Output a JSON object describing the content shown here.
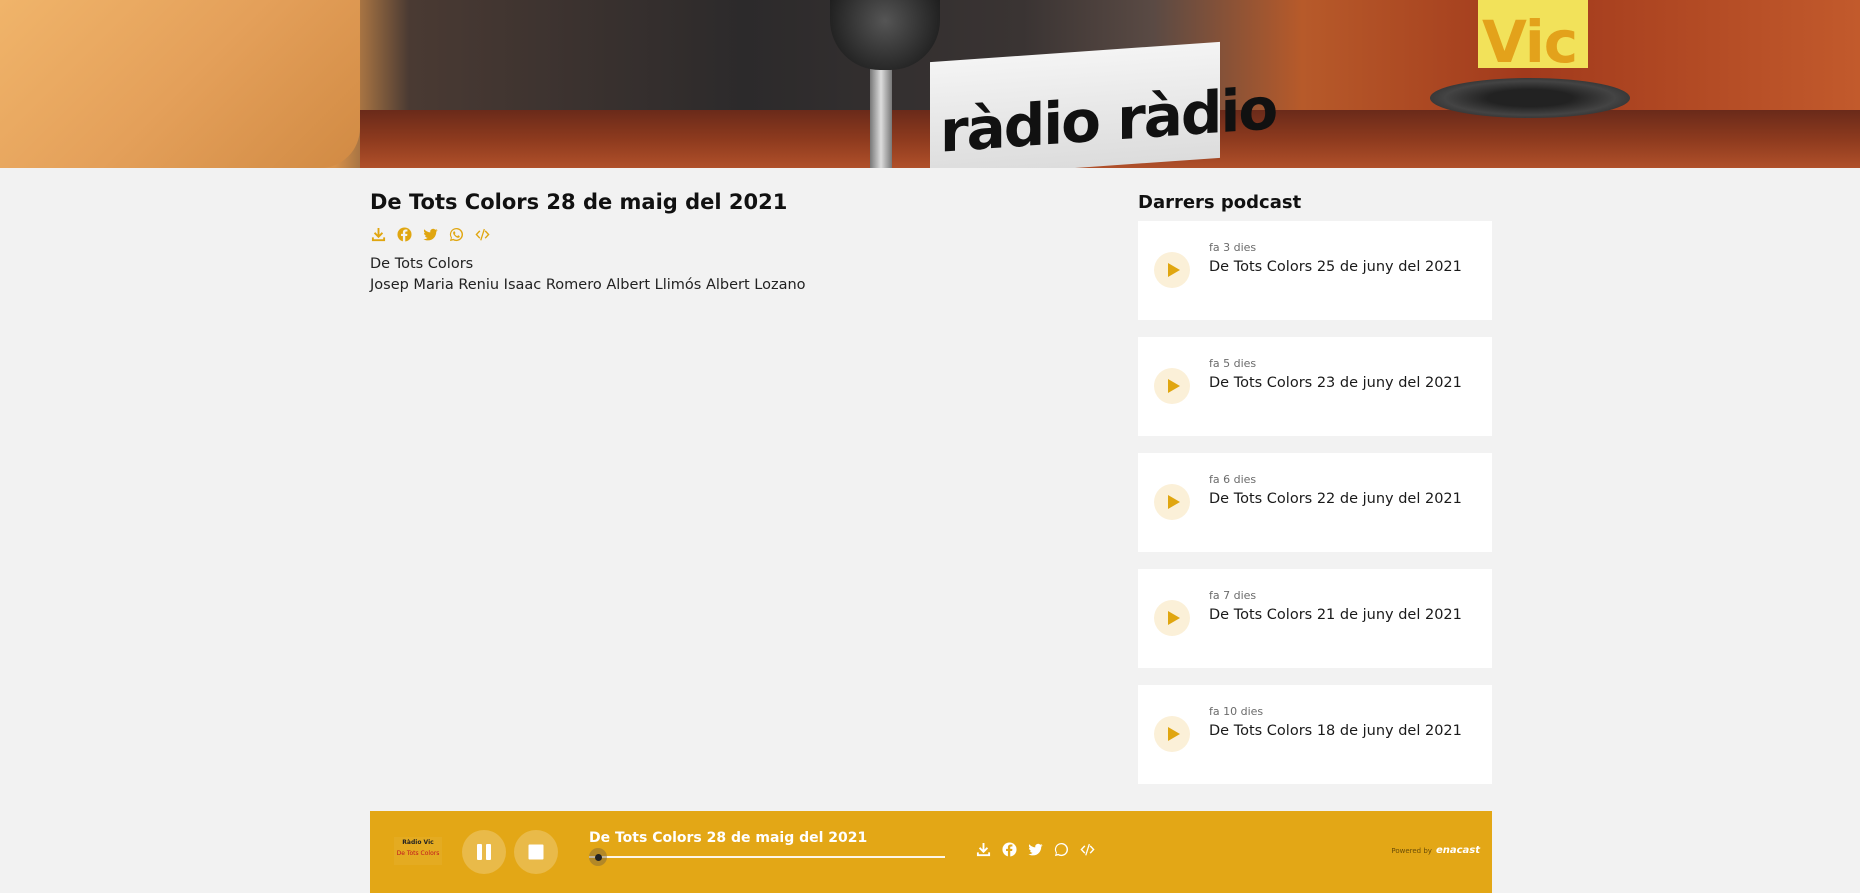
{
  "banner": {
    "cube_text": "ràdio ràdio",
    "sign_text": "Vic"
  },
  "episode": {
    "title": "De Tots Colors 28 de maig del 2021",
    "program": "De Tots Colors",
    "hosts": "Josep Maria Reniu Isaac Romero Albert Llimós Albert Lozano",
    "share_icons": [
      "download-icon",
      "facebook-icon",
      "twitter-icon",
      "whatsapp-icon",
      "embed-code-icon"
    ]
  },
  "sidebar": {
    "title": "Darrers podcast",
    "items": [
      {
        "ago": "fa 3 dies",
        "title": "De Tots Colors 25 de juny del 2021"
      },
      {
        "ago": "fa 5 dies",
        "title": "De Tots Colors 23 de juny del 2021"
      },
      {
        "ago": "fa 6 dies",
        "title": "De Tots Colors 22 de juny del 2021"
      },
      {
        "ago": "fa 7 dies",
        "title": "De Tots Colors 21 de juny del 2021"
      },
      {
        "ago": "fa 10 dies",
        "title": "De Tots Colors 18 de juny del 2021"
      }
    ]
  },
  "player": {
    "logo_line1": "Ràdio Vic",
    "logo_line2": "De Tots Colors",
    "now_playing": "De Tots Colors 28 de maig del 2021",
    "progress": 0.0,
    "powered_by": "Powered by",
    "brand": "enacast"
  },
  "colors": {
    "accent": "#e3a716",
    "icon_accent": "#e0a610",
    "background": "#f2f2f2",
    "card": "#ffffff"
  }
}
